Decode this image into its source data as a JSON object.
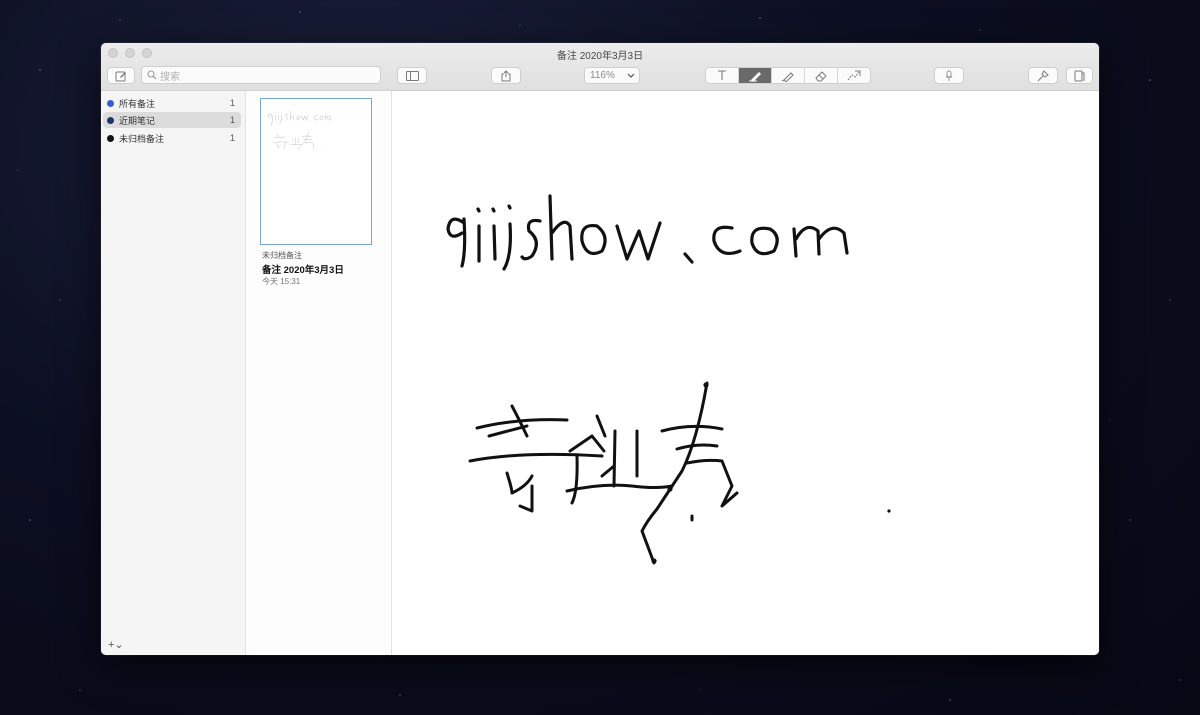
{
  "window": {
    "title": "备注 2020年3月3日"
  },
  "toolbar": {
    "search_placeholder": "搜索",
    "zoom": "116%",
    "icons": [
      "compose-icon",
      "search-icon",
      "sidebar-toggle-icon",
      "share-icon",
      "chevron-down-icon",
      "text-tool-icon",
      "pen-tool-icon",
      "highlighter-tool-icon",
      "eraser-tool-icon",
      "lasso-tool-icon",
      "microphone-icon",
      "pin-icon",
      "notes-pane-icon"
    ],
    "active_tool": "pen"
  },
  "sidebar": {
    "items": [
      {
        "label": "所有备注",
        "count": "1",
        "dot_color": "#3a5bd8"
      },
      {
        "label": "近期笔记",
        "count": "1",
        "dot_color": "#1f3370"
      },
      {
        "label": "未归档备注",
        "count": "1",
        "dot_color": "#111111"
      }
    ],
    "selected_index": 1,
    "add_label": "+⌄"
  },
  "notelist": {
    "items": [
      {
        "folder": "未归档备注",
        "title": "备注 2020年3月3日",
        "time": "今天 15:31"
      }
    ]
  },
  "canvas": {
    "handwriting": [
      "qijishow.com",
      "奇迹秀"
    ]
  },
  "colors": {
    "selection_border": "#7aa3d6",
    "active_tool_bg": "#6a6a6a"
  }
}
